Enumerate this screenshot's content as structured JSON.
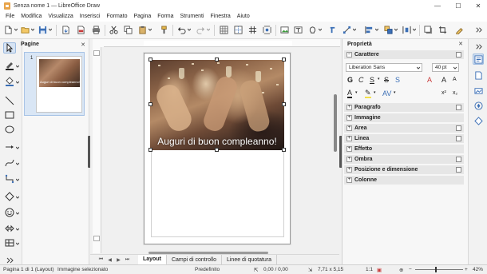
{
  "window": {
    "title": "Senza nome 1 — LibreOffice Draw",
    "minimize": "—",
    "maximize": "☐",
    "close": "✕"
  },
  "menu": [
    "File",
    "Modifica",
    "Visualizza",
    "Inserisci",
    "Formato",
    "Pagina",
    "Forma",
    "Strumenti",
    "Finestra",
    "Aiuto"
  ],
  "pages_pane": {
    "title": "Pagine",
    "close": "✕",
    "page_number": "1",
    "thumb_caption": "Auguri di buon compleanno!"
  },
  "slide": {
    "caption": "Auguri di buon compleanno!"
  },
  "tabs": {
    "nav": [
      "⏮",
      "◀",
      "▶",
      "⏭"
    ],
    "items": [
      "Layout",
      "Campi di controllo",
      "Linee di quotatura"
    ]
  },
  "sidebar": {
    "title": "Proprietà",
    "close": "✕",
    "character_section": "Carattere",
    "font_name": "Liberation Sans",
    "font_size": "40 pt",
    "sections": [
      "Paragrafo",
      "Immagine",
      "Area",
      "Linea",
      "Effetto",
      "Ombra",
      "Posizione e dimensione",
      "Colonne"
    ]
  },
  "status": {
    "page": "Pagina 1 di 1 (Layout)",
    "selection": "Immagine selezionato",
    "layout": "Predefinito",
    "position": "0,00 / 0,00",
    "size": "7,71 x 5,15",
    "scale": "1:1",
    "zoom": "42%"
  },
  "colors": {
    "accent": "#3b7bd4",
    "selected_bg": "#d6e3f3"
  }
}
